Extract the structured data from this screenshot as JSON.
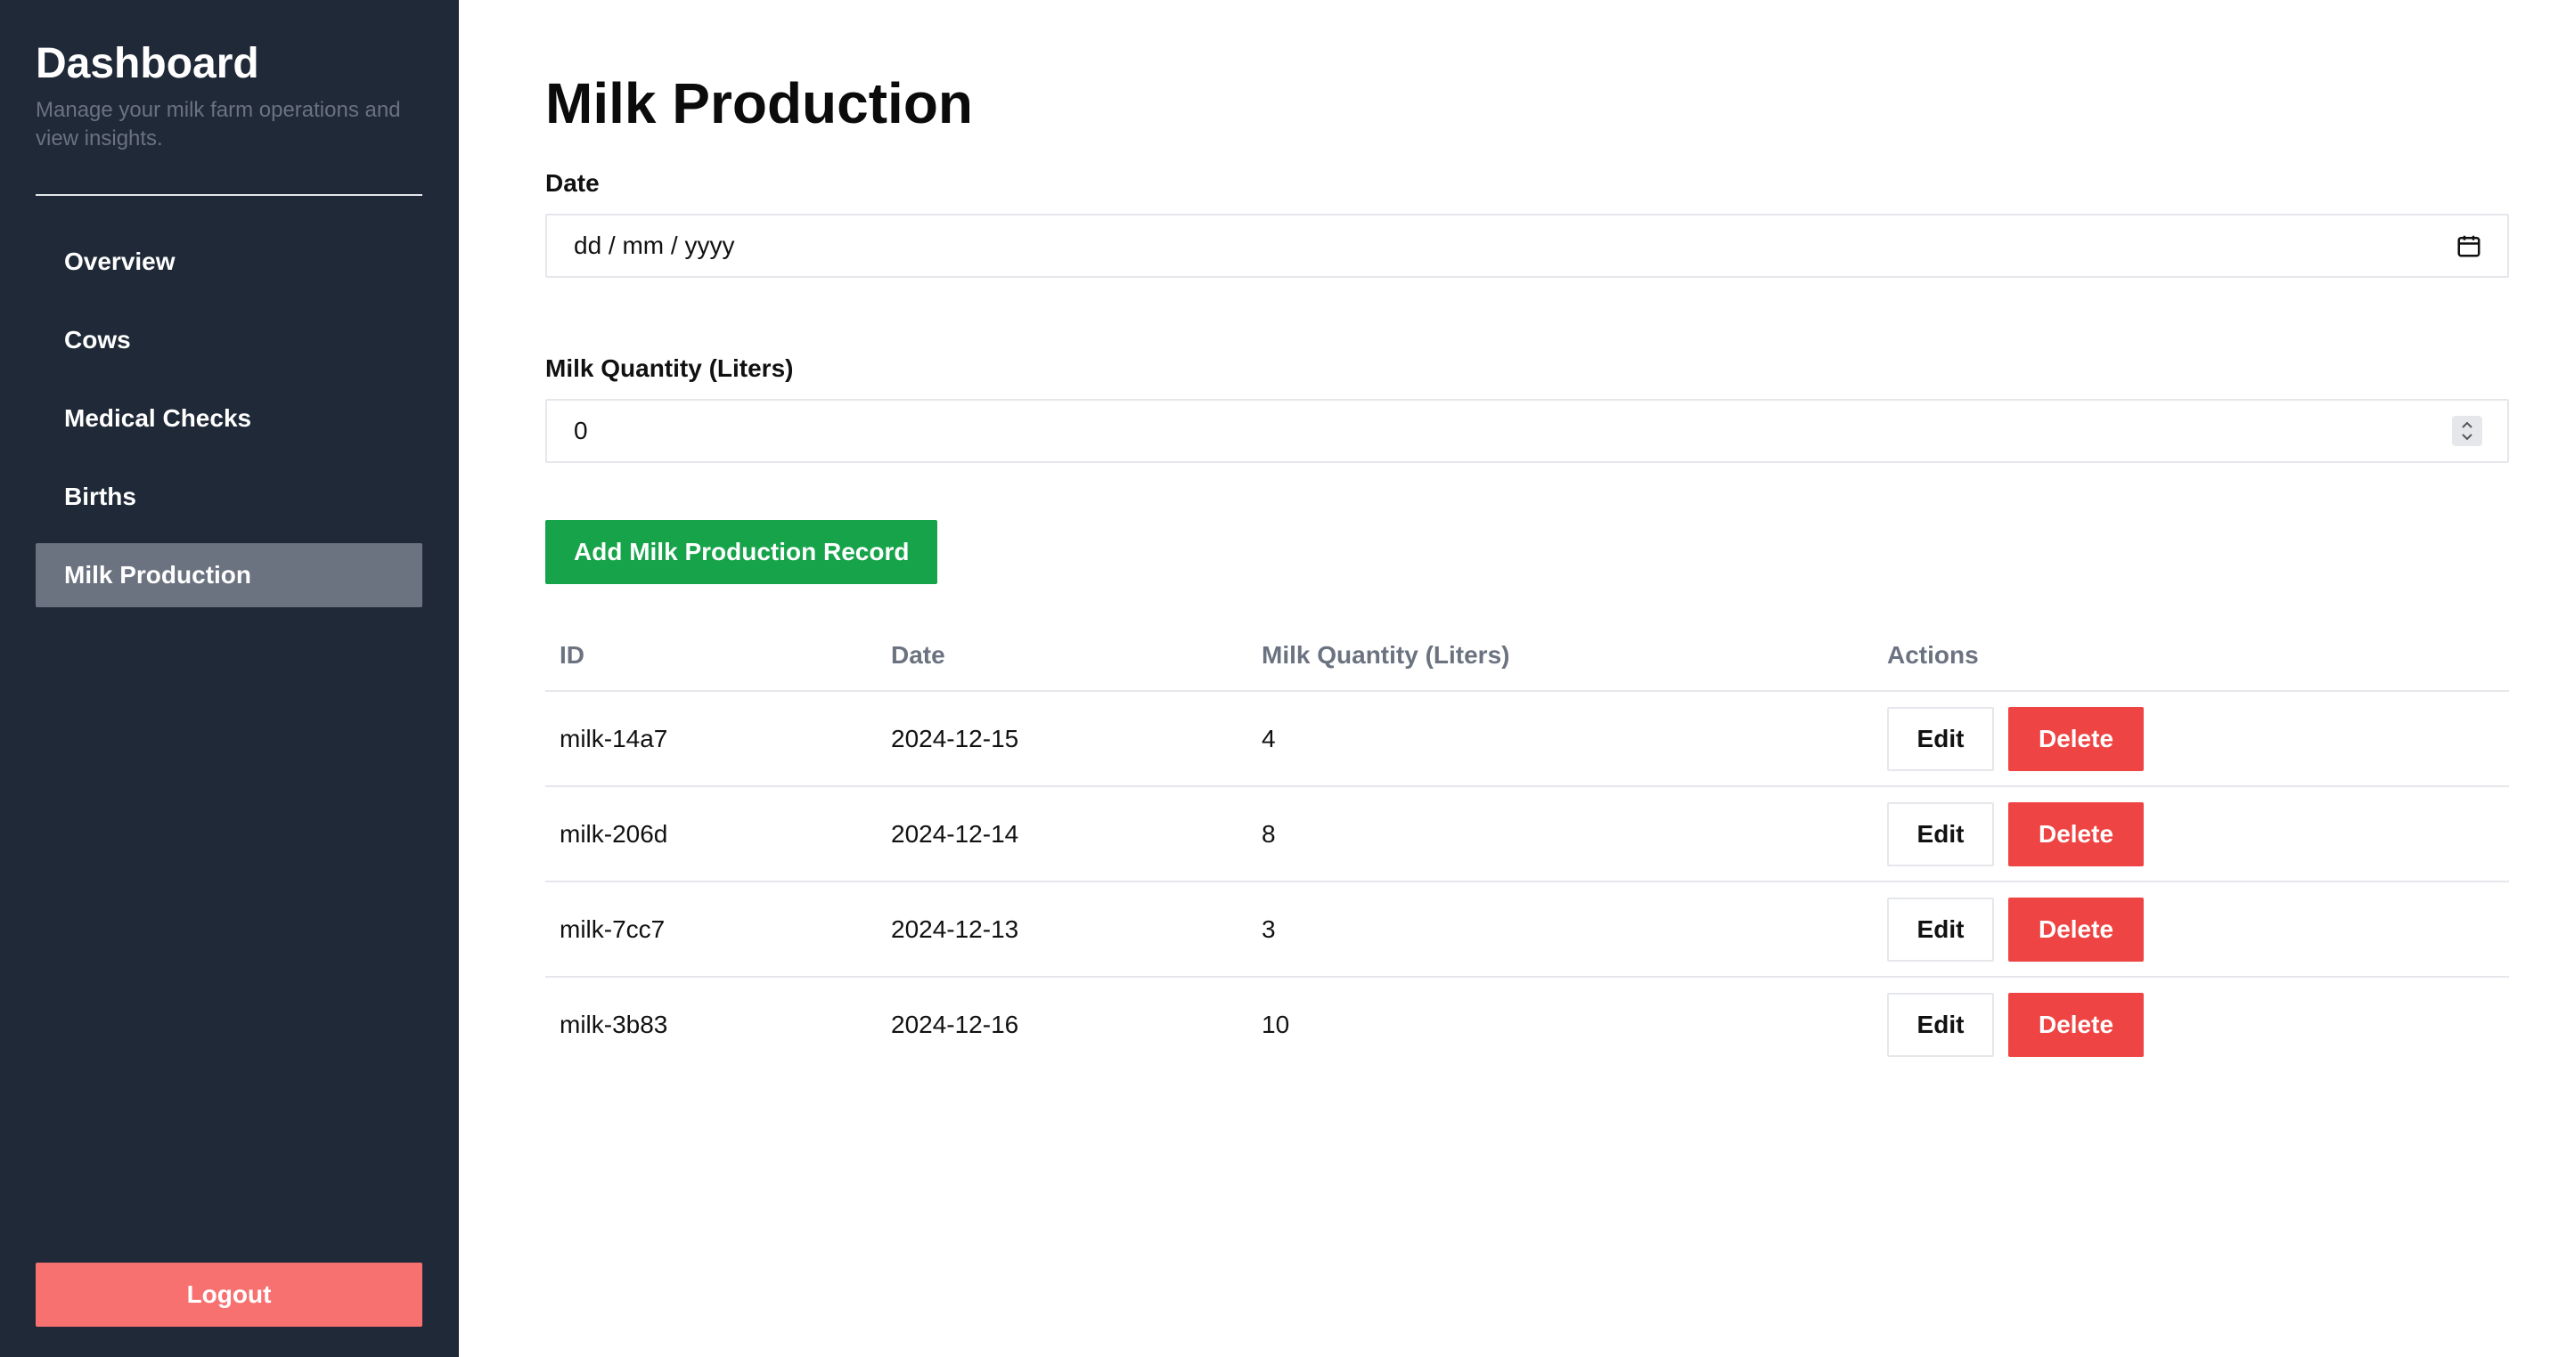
{
  "sidebar": {
    "title": "Dashboard",
    "subtitle": "Manage your milk farm operations and view insights.",
    "items": [
      {
        "label": "Overview"
      },
      {
        "label": "Cows"
      },
      {
        "label": "Medical Checks"
      },
      {
        "label": "Births"
      },
      {
        "label": "Milk Production",
        "active": true
      }
    ],
    "logout_label": "Logout"
  },
  "main": {
    "title": "Milk Production",
    "date_label": "Date",
    "date_placeholder": "dd / mm / yyyy",
    "quantity_label": "Milk Quantity (Liters)",
    "quantity_value": "0",
    "add_button": "Add Milk Production Record",
    "table": {
      "headers": [
        "ID",
        "Date",
        "Milk Quantity (Liters)",
        "Actions"
      ],
      "rows": [
        {
          "id": "milk-14a7",
          "date": "2024-12-15",
          "quantity": "4"
        },
        {
          "id": "milk-206d",
          "date": "2024-12-14",
          "quantity": "8"
        },
        {
          "id": "milk-7cc7",
          "date": "2024-12-13",
          "quantity": "3"
        },
        {
          "id": "milk-3b83",
          "date": "2024-12-16",
          "quantity": "10"
        }
      ],
      "edit_label": "Edit",
      "delete_label": "Delete"
    }
  },
  "colors": {
    "sidebar_bg": "#1f2937",
    "active_item": "#6b7280",
    "logout": "#f87171",
    "add_button": "#16a34a",
    "delete_button": "#ef4444"
  },
  "icons": {
    "date_field": "calendar-icon",
    "quantity_field": "spinner-icon"
  }
}
